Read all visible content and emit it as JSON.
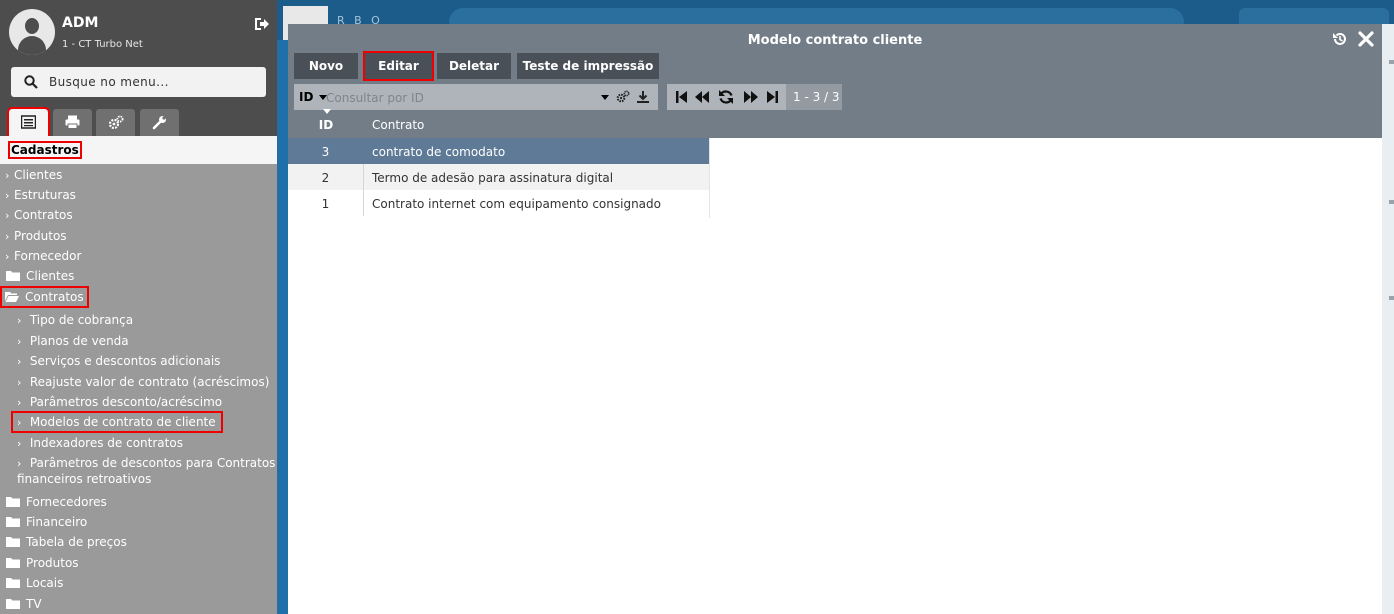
{
  "user": {
    "name": "ADM",
    "company": "1 - CT Turbo Net"
  },
  "search": {
    "placeholder": "Busque no menu..."
  },
  "topbar": {
    "brand": "R B O"
  },
  "menu": {
    "section": "Cadastros",
    "top_items": [
      "Clientes",
      "Estruturas",
      "Contratos",
      "Produtos",
      "Fornecedor"
    ],
    "folder_clientes": "Clientes",
    "folder_contratos": "Contratos",
    "sub_items": [
      "Tipo de cobrança",
      "Planos de venda",
      "Serviços e descontos adicionais",
      "Reajuste valor de contrato (acréscimos)",
      "Parâmetros desconto/acréscimo",
      "Modelos de contrato de cliente",
      "Indexadores de contratos",
      "Parâmetros de descontos para Contratos com",
      "financeiros retroativos"
    ],
    "folders_bottom": [
      "Fornecedores",
      "Financeiro",
      "Tabela de preços",
      "Produtos",
      "Locais",
      "TV"
    ]
  },
  "modal": {
    "title": "Modelo contrato cliente",
    "buttons": {
      "novo": "Novo",
      "editar": "Editar",
      "deletar": "Deletar",
      "teste": "Teste de impressão"
    },
    "filter": {
      "field": "ID",
      "placeholder": "Consultar por ID"
    },
    "pager": {
      "count": "1 - 3 / 3"
    },
    "columns": {
      "id": "ID",
      "contrato": "Contrato"
    },
    "rows": [
      {
        "id": "3",
        "contrato": "contrato de comodato"
      },
      {
        "id": "2",
        "contrato": "Termo de adesão para assinatura digital"
      },
      {
        "id": "1",
        "contrato": "Contrato internet com equipamento consignado"
      }
    ]
  },
  "colors": {
    "highlight": "#e00000",
    "selected_row": "#5e7a96",
    "modal_header": "#737d87",
    "button": "#4a5058"
  }
}
